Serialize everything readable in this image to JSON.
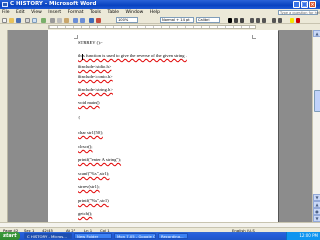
{
  "window": {
    "title": "C HISTORY - Microsoft Word",
    "minimize": "_",
    "maximize": "□",
    "close": "×"
  },
  "menu": {
    "items": [
      "File",
      "Edit",
      "View",
      "Insert",
      "Format",
      "Tools",
      "Table",
      "Window",
      "Help"
    ],
    "help_placeholder": "Type a question for help"
  },
  "toolbar": {
    "zoom": "100%",
    "style": "Normal + 14 pt",
    "font": "Calibri"
  },
  "document": {
    "lines": [
      "STRREV ():-",
      "this function is used to give the reverse of the given string .",
      "#include<stdio.h>",
      "#include<conio.h>",
      "#include<string.h>",
      "void main()",
      "{",
      "char str1[50];",
      "clrscr();",
      "printf(\"enter A string\");",
      "scanf(\"%s\",str1);",
      "strrev(str1);",
      "printf(\"%s\",str1)",
      "getch();",
      "}"
    ]
  },
  "status": {
    "page": "Page 42",
    "sec": "Sec 1",
    "pages": "42/45",
    "at": "At 2\"",
    "ln": "Ln 1",
    "col": "Col 1",
    "language": "English (U.S"
  },
  "taskbar": {
    "start": "start",
    "tasks": [
      "C HISTORY - Micros...",
      "New Folder",
      "Mon 7.05 - Google Ch...",
      "Recording..."
    ],
    "clock": "12:00 PM"
  }
}
